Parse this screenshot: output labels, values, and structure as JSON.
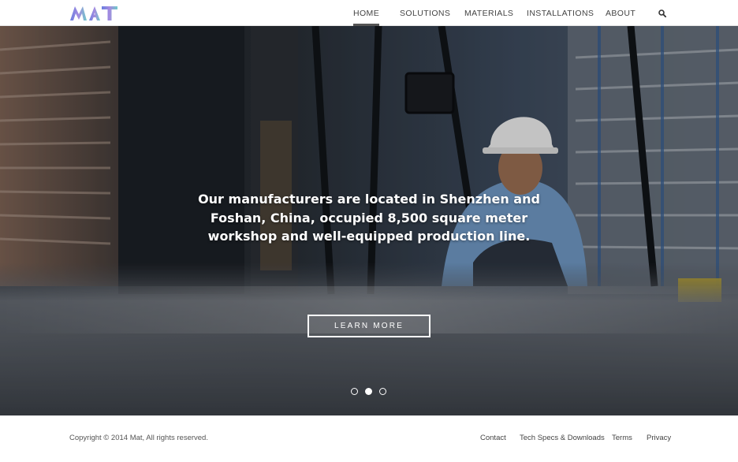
{
  "brand": {
    "logo_text": "MAT",
    "colors": {
      "logo_gradient_start": "#6a7fe0",
      "logo_gradient_mid": "#a58be0",
      "logo_gradient_end": "#6fc9c9"
    }
  },
  "nav": {
    "items": [
      {
        "label": "HOME",
        "active": true
      },
      {
        "label": "SOLUTIONS",
        "active": false
      },
      {
        "label": "MATERIALS",
        "active": false
      },
      {
        "label": "INSTALLATIONS",
        "active": false
      },
      {
        "label": "ABOUT",
        "active": false
      }
    ],
    "search_icon": "search-icon"
  },
  "hero": {
    "headline": "Our manufacturers are located in Shenzhen and Foshan, China, occupied 8,500 square meter workshop and well-equipped production line.",
    "cta_label": "LEARN MORE",
    "slides_total": 3,
    "active_slide": 2,
    "image_subject": "forklift-operator-in-warehouse"
  },
  "footer": {
    "copyright": "Copyright © 2014 Mat, All rights reserved.",
    "links": [
      {
        "label": "Contact"
      },
      {
        "label": "Tech Specs & Downloads"
      },
      {
        "label": "Terms"
      },
      {
        "label": "Privacy"
      }
    ]
  }
}
